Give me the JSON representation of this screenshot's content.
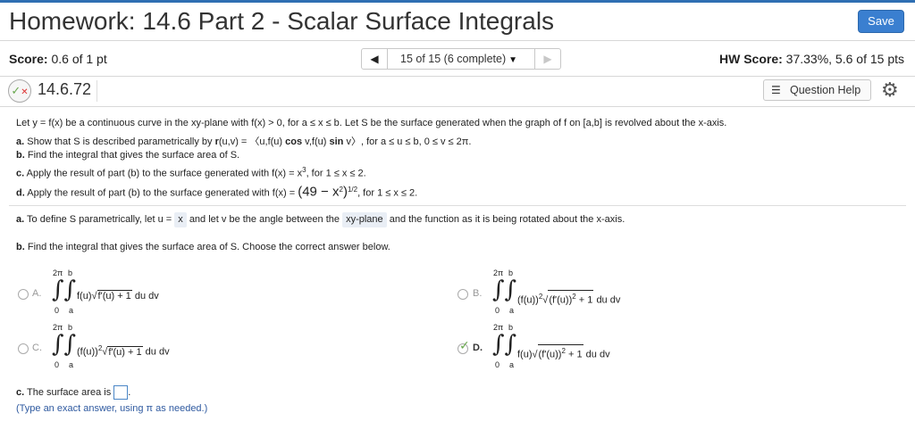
{
  "header": {
    "title": "Homework: 14.6 Part 2 - Scalar Surface Integrals",
    "save_label": "Save"
  },
  "scorebar": {
    "score_label": "Score:",
    "score_value": "0.6 of 1 pt",
    "nav_prev": "◀",
    "nav_status": "15 of 15 (6 complete)",
    "nav_caret": "▼",
    "nav_next": "▶",
    "hw_label": "HW Score:",
    "hw_value": "37.33%, 5.6 of 15 pts"
  },
  "question_bar": {
    "number": "14.6.72",
    "help_label": "Question Help"
  },
  "problem": {
    "intro": "Let y = f(x) be a continuous curve in the xy-plane with f(x) > 0, for a ≤ x ≤ b. Let S be the surface generated when the graph of f on [a,b] is revolved about the x-axis.",
    "a_label": "a.",
    "a_pre": "Show that S is described parametrically by",
    "a_r": "r",
    "a_mid": "(u,v) = 〈u,f(u)",
    "a_cos": "cos",
    "a_mid2": "v,f(u)",
    "a_sin": "sin",
    "a_post": "v〉, for a ≤ u ≤ b, 0 ≤ v ≤ 2π.",
    "b_label": "b.",
    "b_text": "Find the integral that gives the surface area of S.",
    "c_label": "c.",
    "c_text_pre": "Apply the result of part (b) to the surface generated with f(x) = x",
    "c_exp": "3",
    "c_text_post": ", for 1 ≤ x ≤ 2.",
    "d_label": "d.",
    "d_text_pre": "Apply the result of part (b) to the surface generated with f(x) =",
    "d_inner": "(49 − x",
    "d_inner_exp": "2",
    "d_inner_close": ")",
    "d_exp": "1/2",
    "d_text_post": ", for 1 ≤ x ≤ 2."
  },
  "part_a": {
    "label": "a.",
    "pre": "To define S parametrically, let u =",
    "answer_u": "x",
    "mid": "and let v be the angle between the",
    "answer_plane": "xy-plane",
    "post": "and the function as it is being rotated about the x-axis."
  },
  "part_b": {
    "label": "b.",
    "text": "Find the integral that gives the surface area of S. Choose the correct answer below.",
    "options": [
      {
        "letter": "A.",
        "upper_outer": "2π",
        "upper_inner": "b",
        "lower_outer": "0",
        "lower_inner": "a",
        "pre": "f(u)",
        "radicand": "f'(u) + 1",
        "post": "du dv",
        "selected": false
      },
      {
        "letter": "B.",
        "upper_outer": "2π",
        "upper_inner": "b",
        "lower_outer": "0",
        "lower_inner": "a",
        "pre": "(f(u))",
        "pre_exp": "2",
        "radicand": "(f'(u))",
        "radicand_exp": "2",
        "radicand_post": " + 1",
        "post": "du dv",
        "selected": false
      },
      {
        "letter": "C.",
        "upper_outer": "2π",
        "upper_inner": "b",
        "lower_outer": "0",
        "lower_inner": "a",
        "pre": "(f(u))",
        "pre_exp": "2",
        "radicand": "f'(u) + 1",
        "post": "du dv",
        "selected": false
      },
      {
        "letter": "D.",
        "upper_outer": "2π",
        "upper_inner": "b",
        "lower_outer": "0",
        "lower_inner": "a",
        "pre": "f(u)",
        "radicand": "(f'(u))",
        "radicand_exp": "2",
        "radicand_post": " + 1",
        "post": "du dv",
        "selected": true
      }
    ]
  },
  "part_c": {
    "label": "c.",
    "text": "The surface area is",
    "period": ".",
    "hint": "(Type an exact answer, using π as needed.)"
  },
  "colors": {
    "accent": "#3a7fd0",
    "correct": "#6aa84f",
    "hint": "#2f5aa0"
  }
}
